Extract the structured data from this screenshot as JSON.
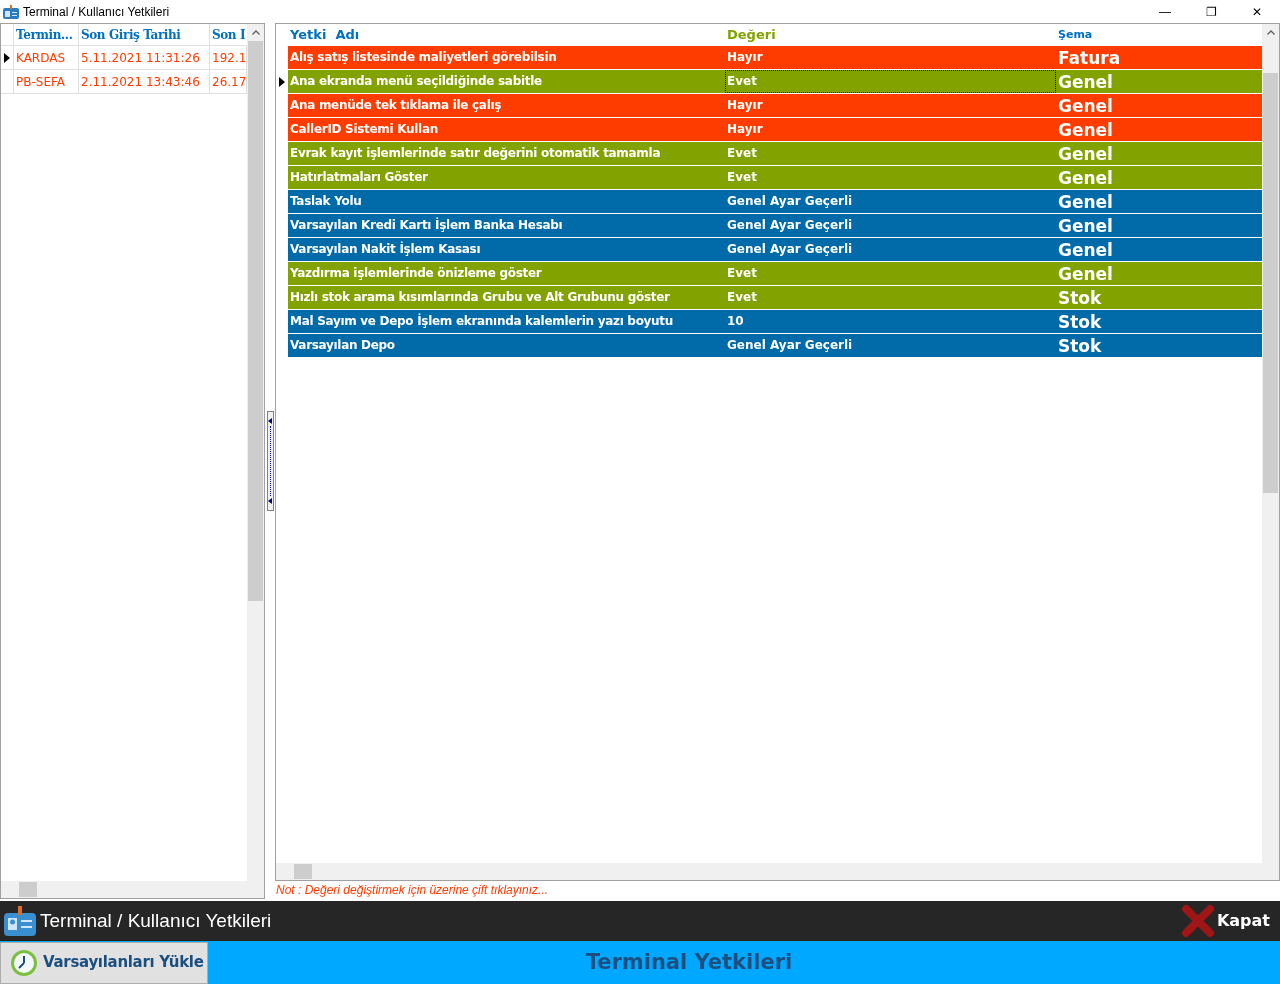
{
  "window": {
    "title": "Terminal / Kullanıcı Yetkileri",
    "controls": [
      "—",
      "❐",
      "✕"
    ]
  },
  "terminals": {
    "columns": [
      "Termin...",
      "Son Giriş Tarihi",
      "Son I"
    ],
    "rows": [
      {
        "cells": [
          "KARDAS",
          "5.11.2021 11:31:26",
          "192.1"
        ],
        "selected": true
      },
      {
        "cells": [
          "PB-SEFA",
          "2.11.2021 13:43:46",
          "26.17"
        ],
        "selected": false
      }
    ]
  },
  "permissions": {
    "columns": [
      "Yetki  Adı",
      "Değeri",
      "Şema"
    ],
    "rows": [
      {
        "name": "Alış satış listesinde maliyetleri görebilsin",
        "value": "Hayır",
        "schema": "Fatura",
        "color": "#ff3c00",
        "selected": false
      },
      {
        "name": "Ana ekranda menü seçildiğinde sabitle",
        "value": "Evet",
        "schema": "Genel",
        "color": "#82a200",
        "selected": true
      },
      {
        "name": "Ana menüde tek tıklama ile çalış",
        "value": "Hayır",
        "schema": "Genel",
        "color": "#ff3c00",
        "selected": false
      },
      {
        "name": "CallerID Sistemi Kullan",
        "value": "Hayır",
        "schema": "Genel",
        "color": "#ff3c00",
        "selected": false
      },
      {
        "name": "Evrak kayıt işlemlerinde satır değerini otomatik tamamla",
        "value": "Evet",
        "schema": "Genel",
        "color": "#82a200",
        "selected": false
      },
      {
        "name": "Hatırlatmaları Göster",
        "value": "Evet",
        "schema": "Genel",
        "color": "#82a200",
        "selected": false
      },
      {
        "name": "Taslak Yolu",
        "value": "Genel Ayar Geçerli",
        "schema": "Genel",
        "color": "#006ba8",
        "selected": false
      },
      {
        "name": "Varsayılan Kredi Kartı İşlem Banka Hesabı",
        "value": "Genel Ayar Geçerli",
        "schema": "Genel",
        "color": "#006ba8",
        "selected": false
      },
      {
        "name": "Varsayılan Nakit İşlem Kasası",
        "value": "Genel Ayar Geçerli",
        "schema": "Genel",
        "color": "#006ba8",
        "selected": false
      },
      {
        "name": "Yazdırma işlemlerinde önizleme göster",
        "value": "Evet",
        "schema": "Genel",
        "color": "#82a200",
        "selected": false
      },
      {
        "name": "Hızlı stok arama kısımlarında Grubu ve Alt Grubunu göster",
        "value": "Evet",
        "schema": "Stok",
        "color": "#82a200",
        "selected": false
      },
      {
        "name": "Mal Sayım ve Depo İşlem ekranında kalemlerin yazı boyutu",
        "value": "10",
        "schema": "Stok",
        "color": "#006ba8",
        "selected": false
      },
      {
        "name": "Varsayılan Depo",
        "value": "Genel Ayar Geçerli",
        "schema": "Stok",
        "color": "#006ba8",
        "selected": false
      }
    ]
  },
  "note": "Not : Değeri değiştirmek için üzerine çift tıklayınız...",
  "header_bar": {
    "title": "Terminal / Kullanıcı Yetkileri",
    "close_button": "Kapat"
  },
  "footer": {
    "button": "Varsayılanları Yükle",
    "title": "Terminal Yetkileri"
  }
}
